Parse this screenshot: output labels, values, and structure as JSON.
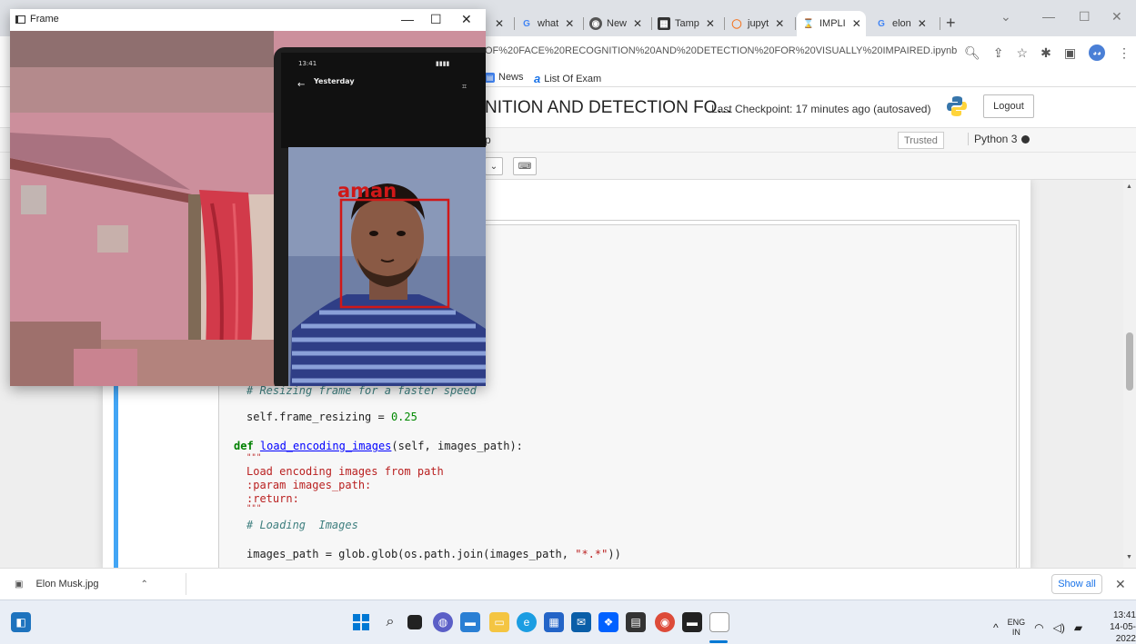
{
  "browser": {
    "tabs": [
      {
        "label": "✕",
        "icon": "tab-icon"
      },
      {
        "label": "what",
        "icon": "google-g-icon"
      },
      {
        "label": "New",
        "icon": "chrome-icon"
      },
      {
        "label": "Tamp",
        "icon": "store-icon"
      },
      {
        "label": "jupyt",
        "icon": "jupyter-icon"
      },
      {
        "label": "IMPLI",
        "icon": "hourglass-icon"
      },
      {
        "label": "elon",
        "icon": "google-g-icon"
      }
    ],
    "url": "OF%20FACE%20RECOGNITION%20AND%20DETECTION%20FOR%20VISUALLY%20IMPAIRED.ipynb",
    "bookmarks": [
      {
        "label": "News"
      },
      {
        "label": "List Of Exam"
      }
    ]
  },
  "jupyter": {
    "title": "NITION AND DETECTION FO...",
    "checkpoint": "Last Checkpoint: 17 minutes ago  (autosaved)",
    "logout_label": "Logout",
    "trusted_label": "Trusted",
    "kernel_label": "Python 3",
    "menu_fragment": "p"
  },
  "code": {
    "line1": "# Resizing frame for a faster speed",
    "line2_a": "self.frame_resizing = ",
    "line2_b": "0.25",
    "line3_kw": "def ",
    "line3_fn": "load_encoding_images",
    "line3_rest": "(self, images_path):",
    "doc_open": "\"\"\"",
    "doc_1": "Load encoding images from path",
    "doc_2": ":param images_path:",
    "doc_3": ":return:",
    "doc_close": "\"\"\"",
    "line4": "# Loading  Images",
    "line5_a": "images_path = glob.glob(os.path.join(images_path, ",
    "line5_b": "\"*.*\"",
    "line5_c": "))"
  },
  "download": {
    "file_name": "Elon Musk.jpg",
    "show_all": "Show all"
  },
  "frame_window": {
    "title": "Frame",
    "face_label": "aman",
    "phone_time": "13:41",
    "phone_header": "Yesterday"
  },
  "taskbar": {
    "lang_1": "ENG",
    "lang_2": "IN",
    "time": "13:41",
    "date": "14-05-2022"
  }
}
